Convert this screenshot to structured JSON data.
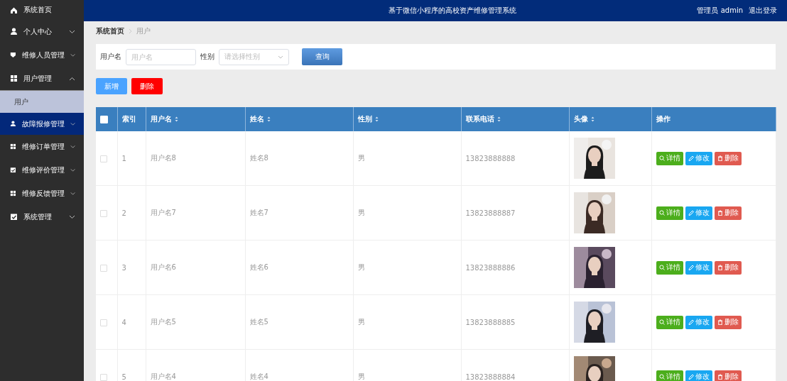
{
  "header": {
    "title": "基于微信小程序的高校资产维修管理系统",
    "user": "管理员 admin",
    "logout": "退出登录"
  },
  "sidebar": {
    "items": [
      {
        "label": "系统首页",
        "kind": "home",
        "expandable": false,
        "hovered": false
      },
      {
        "label": "个人中心",
        "kind": "user",
        "expandable": true,
        "expanded": false,
        "hovered": false
      },
      {
        "label": "维修人员管理",
        "kind": "badge",
        "expandable": true,
        "expanded": false,
        "hovered": false
      },
      {
        "label": "用户管理",
        "kind": "grid",
        "expandable": true,
        "expanded": true,
        "hovered": false,
        "children": [
          {
            "label": "用户",
            "selected": true
          }
        ]
      },
      {
        "label": "故障报修管理",
        "kind": "user",
        "expandable": true,
        "expanded": false,
        "hovered": true
      },
      {
        "label": "维修订单管理",
        "kind": "grid",
        "expandable": true,
        "expanded": false,
        "hovered": false
      },
      {
        "label": "维修评价管理",
        "kind": "check",
        "expandable": true,
        "expanded": false,
        "hovered": false
      },
      {
        "label": "维修反馈管理",
        "kind": "grid",
        "expandable": true,
        "expanded": false,
        "hovered": false
      },
      {
        "label": "系统管理",
        "kind": "check",
        "expandable": true,
        "expanded": false,
        "hovered": false
      }
    ]
  },
  "breadcrumb": [
    "系统首页",
    "用户"
  ],
  "search": {
    "fields": [
      {
        "label": "用户名",
        "placeholder": "用户名",
        "kind": "text"
      },
      {
        "label": "性别",
        "placeholder": "请选择性别",
        "kind": "select"
      }
    ],
    "button": "查询"
  },
  "actions": [
    {
      "label": "新增",
      "kind": "add"
    },
    {
      "label": "删除",
      "kind": "delete"
    }
  ],
  "table": {
    "header_checkbox": {
      "checked": false
    },
    "columns": [
      {
        "label": "索引",
        "sortable": false
      },
      {
        "label": "用户名",
        "sortable": true
      },
      {
        "label": "姓名",
        "sortable": true
      },
      {
        "label": "性别",
        "sortable": true
      },
      {
        "label": "联系电话",
        "sortable": true
      },
      {
        "label": "头像",
        "sortable": true
      },
      {
        "label": "操作",
        "sortable": false
      }
    ],
    "rows": [
      {
        "checked": false,
        "index": "1",
        "username": "用户名8",
        "name": "姓名8",
        "gender": "男",
        "phone": "13823888888",
        "buttons": [
          {
            "label": "详情",
            "kind": "view"
          },
          {
            "label": "修改",
            "kind": "edit"
          },
          {
            "label": "删除",
            "kind": "delete"
          }
        ]
      },
      {
        "checked": false,
        "index": "2",
        "username": "用户名7",
        "name": "姓名7",
        "gender": "男",
        "phone": "13823888887",
        "buttons": [
          {
            "label": "详情",
            "kind": "view"
          },
          {
            "label": "修改",
            "kind": "edit"
          },
          {
            "label": "删除",
            "kind": "delete"
          }
        ]
      },
      {
        "checked": false,
        "index": "3",
        "username": "用户名6",
        "name": "姓名6",
        "gender": "男",
        "phone": "13823888886",
        "buttons": [
          {
            "label": "详情",
            "kind": "view"
          },
          {
            "label": "修改",
            "kind": "edit"
          },
          {
            "label": "删除",
            "kind": "delete"
          }
        ]
      },
      {
        "checked": false,
        "index": "4",
        "username": "用户名5",
        "name": "姓名5",
        "gender": "男",
        "phone": "13823888885",
        "buttons": [
          {
            "label": "详情",
            "kind": "view"
          },
          {
            "label": "修改",
            "kind": "edit"
          },
          {
            "label": "删除",
            "kind": "delete"
          }
        ]
      },
      {
        "checked": false,
        "index": "5",
        "username": "用户名4",
        "name": "姓名4",
        "gender": "男",
        "phone": "13823888884",
        "buttons": [
          {
            "label": "详情",
            "kind": "view"
          },
          {
            "label": "修改",
            "kind": "edit"
          },
          {
            "label": "删除",
            "kind": "delete"
          }
        ]
      }
    ]
  }
}
